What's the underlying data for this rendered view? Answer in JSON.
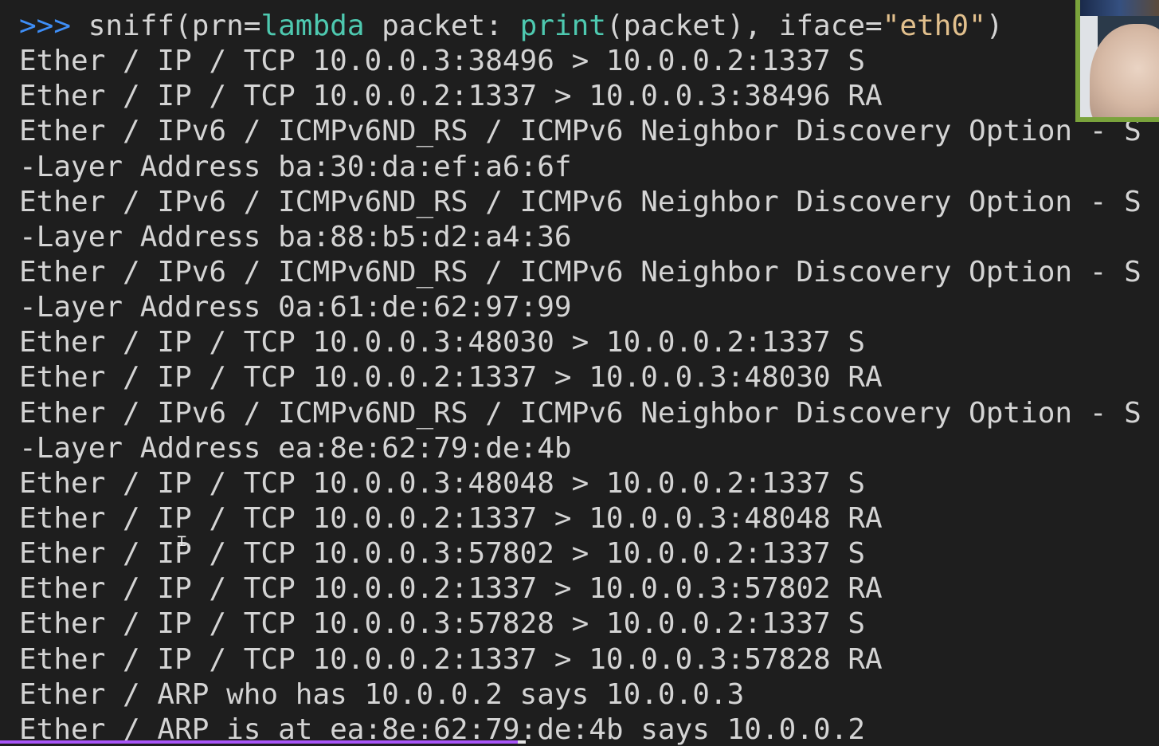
{
  "command": {
    "prompt": ">>>",
    "fn_prefix": " sniff(prn=",
    "keyword": "lambda",
    "middle": " packet: ",
    "builtin": "print",
    "args": "(packet), iface=",
    "string": "\"eth0\"",
    "close": ")"
  },
  "output_lines": [
    "Ether / IP / TCP 10.0.0.3:38496 > 10.0.0.2:1337 S",
    "Ether / IP / TCP 10.0.0.2:1337 > 10.0.0.3:38496 RA",
    "Ether / IPv6 / ICMPv6ND_RS / ICMPv6 Neighbor Discovery Option - S",
    "-Layer Address ba:30:da:ef:a6:6f",
    "Ether / IPv6 / ICMPv6ND_RS / ICMPv6 Neighbor Discovery Option - S",
    "-Layer Address ba:88:b5:d2:a4:36",
    "Ether / IPv6 / ICMPv6ND_RS / ICMPv6 Neighbor Discovery Option - S",
    "-Layer Address 0a:61:de:62:97:99",
    "Ether / IP / TCP 10.0.0.3:48030 > 10.0.0.2:1337 S",
    "Ether / IP / TCP 10.0.0.2:1337 > 10.0.0.3:48030 RA",
    "Ether / IPv6 / ICMPv6ND_RS / ICMPv6 Neighbor Discovery Option - S",
    "-Layer Address ea:8e:62:79:de:4b",
    "Ether / IP / TCP 10.0.0.3:48048 > 10.0.0.2:1337 S",
    "Ether / IP / TCP 10.0.0.2:1337 > 10.0.0.3:48048 RA",
    "Ether / IP / TCP 10.0.0.3:57802 > 10.0.0.2:1337 S",
    "Ether / IP / TCP 10.0.0.2:1337 > 10.0.0.3:57802 RA",
    "Ether / IP / TCP 10.0.0.3:57828 > 10.0.0.2:1337 S",
    "Ether / IP / TCP 10.0.0.2:1337 > 10.0.0.3:57828 RA",
    "Ether / ARP who has 10.0.0.2 says 10.0.0.3",
    "Ether / ARP is at ea:8e:62:79:de:4b says 10.0.0.2"
  ],
  "colors": {
    "background": "#1e1e1e",
    "text": "#d4d4d4",
    "prompt": "#3e8ef7",
    "keyword": "#4ec9b0",
    "string": "#e2c08d",
    "scrollbar": "#a855f7",
    "webcam_border": "#7aa33c"
  },
  "icons": {
    "text_cursor": "ibeam-cursor-icon"
  }
}
